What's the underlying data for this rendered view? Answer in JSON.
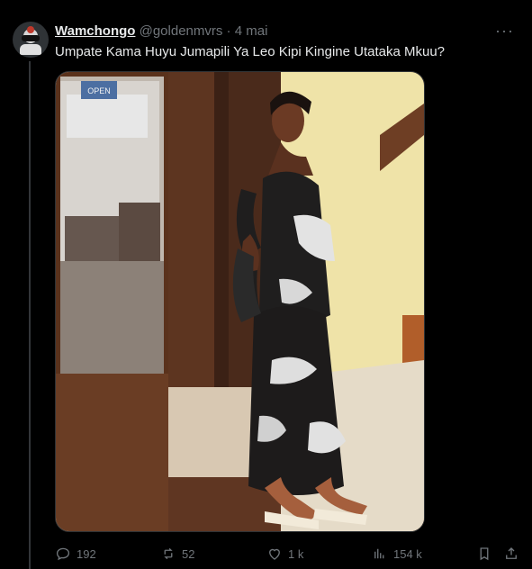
{
  "tweet": {
    "author_name": "Wamchongo",
    "author_handle": "@goldenmvrs",
    "separator": "·",
    "time": "4 mai",
    "more_label": "···",
    "text": "Umpate Kama Huyu Jumapili Ya Leo Kipi Kingine Utataka Mkuu?"
  },
  "media": {
    "sign_text": "OPEN",
    "description_icon": "photo"
  },
  "actions": {
    "replies": "192",
    "retweets": "52",
    "likes": "1 k",
    "views": "154 k"
  },
  "colors": {
    "background": "#000000",
    "text": "#e7e9ea",
    "muted": "#71767b",
    "divider": "#333639"
  }
}
